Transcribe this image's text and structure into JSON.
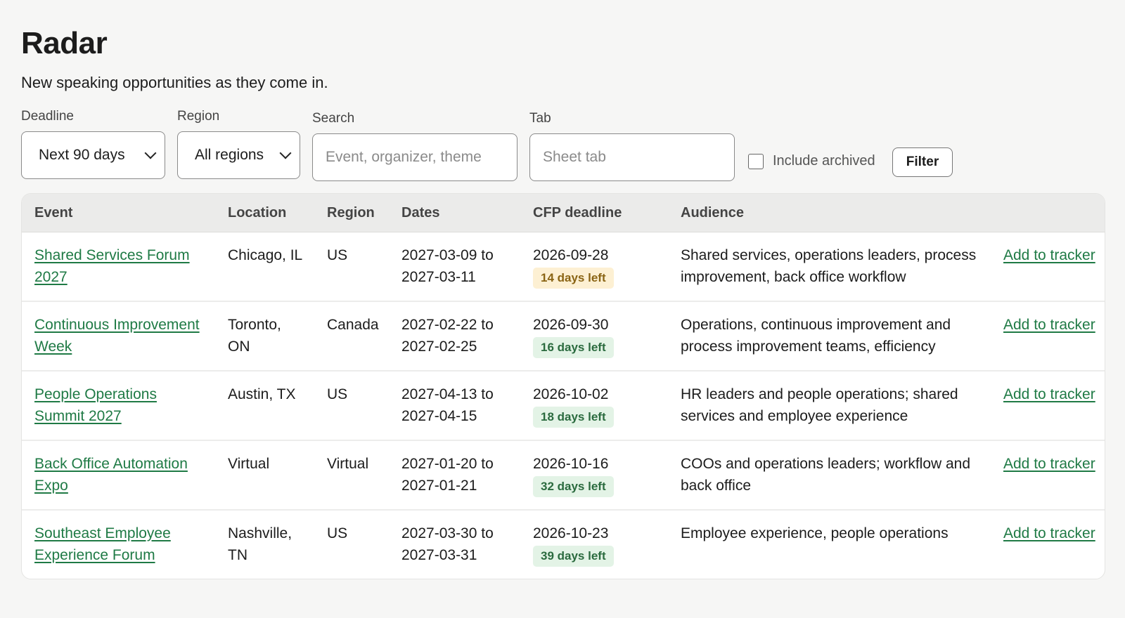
{
  "page": {
    "title": "Radar",
    "subtitle": "New speaking opportunities as they come in."
  },
  "filters": {
    "deadline": {
      "label": "Deadline",
      "value": "Next 90 days"
    },
    "region": {
      "label": "Region",
      "value": "All regions"
    },
    "search": {
      "label": "Search",
      "placeholder": "Event, organizer, theme"
    },
    "tab": {
      "label": "Tab",
      "placeholder": "Sheet tab"
    },
    "include_archived": {
      "label": "Include archived",
      "checked": false
    },
    "filter_button": "Filter"
  },
  "table": {
    "columns": [
      "Event",
      "Location",
      "Region",
      "Dates",
      "CFP deadline",
      "Audience",
      ""
    ],
    "rows": [
      {
        "event": "Shared Services Forum 2027",
        "location": "Chicago, IL",
        "region": "US",
        "dates": "2027-03-09 to 2027-03-11",
        "cfp_deadline": "2026-09-28",
        "days_left": "14 days left",
        "badge_status": "warning",
        "audience": "Shared services, operations leaders, process improvement, back office workflow",
        "action": "Add to tracker"
      },
      {
        "event": "Continuous Improvement Week",
        "location": "Toronto, ON",
        "region": "Canada",
        "dates": "2027-02-22 to 2027-02-25",
        "cfp_deadline": "2026-09-30",
        "days_left": "16 days left",
        "badge_status": "ok",
        "audience": "Operations, continuous improvement and process improvement teams, efficiency",
        "action": "Add to tracker"
      },
      {
        "event": "People Operations Summit 2027",
        "location": "Austin, TX",
        "region": "US",
        "dates": "2027-04-13 to 2027-04-15",
        "cfp_deadline": "2026-10-02",
        "days_left": "18 days left",
        "badge_status": "ok",
        "audience": "HR leaders and people operations; shared services and employee experience",
        "action": "Add to tracker"
      },
      {
        "event": "Back Office Automation Expo",
        "location": "Virtual",
        "region": "Virtual",
        "dates": "2027-01-20 to 2027-01-21",
        "cfp_deadline": "2026-10-16",
        "days_left": "32 days left",
        "badge_status": "ok",
        "audience": "COOs and operations leaders; workflow and back office",
        "action": "Add to tracker"
      },
      {
        "event": "Southeast Employee Experience Forum",
        "location": "Nashville, TN",
        "region": "US",
        "dates": "2027-03-30 to 2027-03-31",
        "cfp_deadline": "2026-10-23",
        "days_left": "39 days left",
        "badge_status": "ok",
        "audience": "Employee experience, people operations",
        "action": "Add to tracker"
      }
    ]
  },
  "colors": {
    "link": "#1f7a45",
    "badge_warning_bg": "#fdf0d3",
    "badge_ok_bg": "#e3f3e6"
  }
}
